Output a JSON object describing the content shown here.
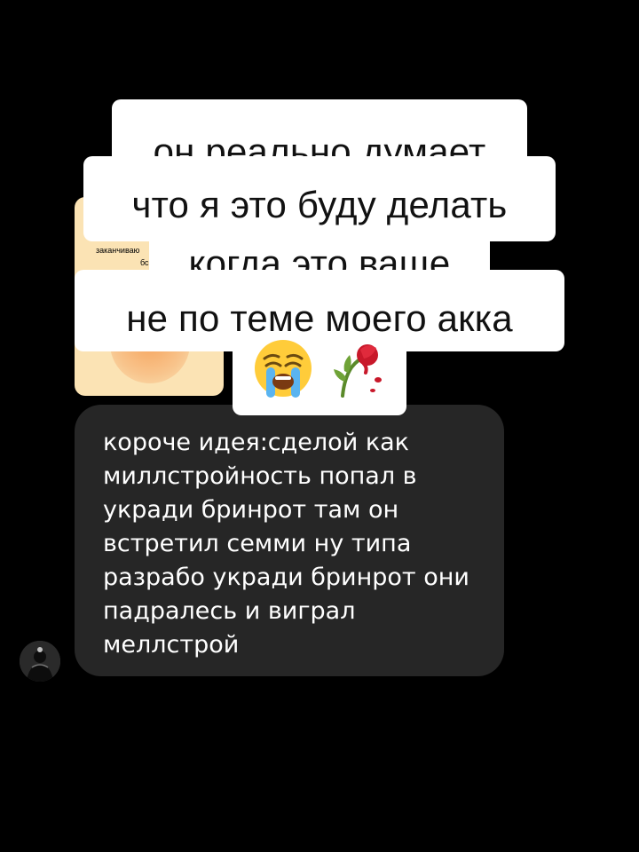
{
  "shared_card": {
    "caption_line1": "заканчиваю",
    "caption_line2": "бс"
  },
  "overlay": {
    "lines": [
      "он реально думает",
      "что я это буду делать",
      "когда это ваще",
      "не по теме моего акка"
    ],
    "emojis": [
      "crying-face-emoji",
      "wilted-rose-emoji"
    ]
  },
  "message": {
    "text": "короче идея:сделой как\nмиллстройность попал в\nукради бринрот там он\nвстретил семми ну типа\nразрабо укради бринрот они\nпадралесь и виграл\nмеллстрой"
  },
  "colors": {
    "background": "#000000",
    "bubble": "#262626",
    "overlay_box": "#ffffff",
    "card": "#fbe3b4"
  }
}
